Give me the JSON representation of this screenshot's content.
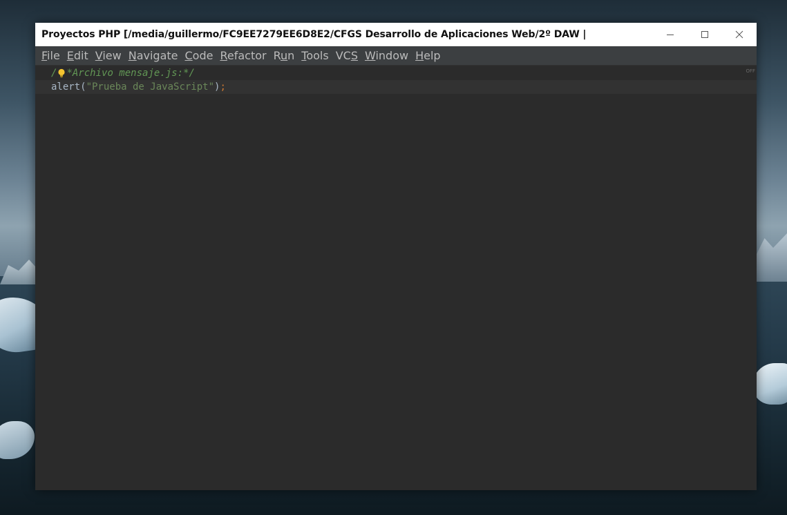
{
  "window": {
    "title": "Proyectos PHP [/media/guillermo/FC9EE7279EE6D8E2/CFGS Desarrollo de Aplicaciones Web/2º DAW |",
    "controls": {
      "minimize_icon": "minimize-icon",
      "maximize_icon": "maximize-icon",
      "close_icon": "close-icon"
    }
  },
  "menu": [
    {
      "mnemonic": "F",
      "rest": "ile"
    },
    {
      "mnemonic": "E",
      "rest": "dit"
    },
    {
      "mnemonic": "V",
      "rest": "iew"
    },
    {
      "mnemonic": "N",
      "rest": "avigate"
    },
    {
      "mnemonic": "C",
      "rest": "ode"
    },
    {
      "mnemonic": "R",
      "rest": "efactor"
    },
    {
      "pre": "R",
      "mnemonic": "u",
      "rest": "n"
    },
    {
      "mnemonic": "T",
      "rest": "ools"
    },
    {
      "pre": "VC",
      "mnemonic": "S",
      "rest": ""
    },
    {
      "mnemonic": "W",
      "rest": "indow"
    },
    {
      "mnemonic": "H",
      "rest": "elp"
    }
  ],
  "editor": {
    "line1": {
      "comment_start": "/",
      "comment_rest": "*Archivo mensaje.js:*/"
    },
    "line2": {
      "call": "alert(",
      "string": "\"Prueba de JavaScript\"",
      "close": ")",
      "semicolon": ";"
    },
    "inspection_toggle": "OFF"
  },
  "colors": {
    "editor_bg": "#2b2b2b",
    "menubar_bg": "#3c3f41",
    "comment": "#629755",
    "string": "#6a8759",
    "keyword": "#cc7832",
    "text": "#a9b7c6"
  }
}
